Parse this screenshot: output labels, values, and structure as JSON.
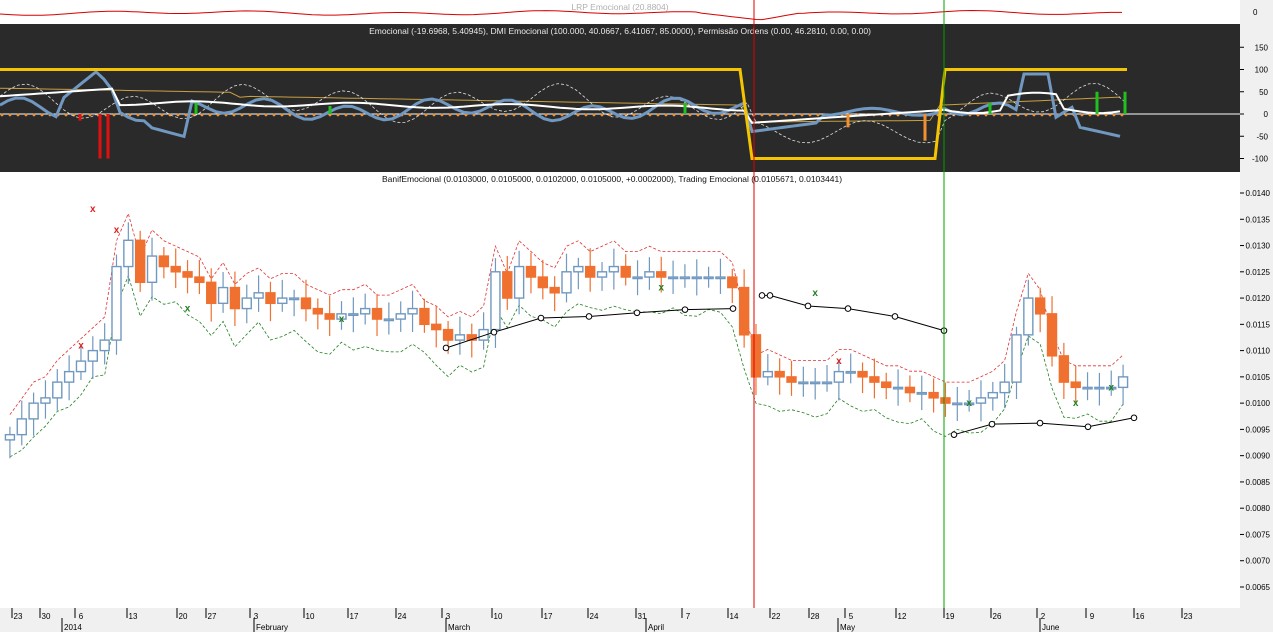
{
  "top_indicator": {
    "title": "LRP Emocional (20.8804)",
    "right_label": "0"
  },
  "oscillator": {
    "title": "Emocional (-19.6968, 5.40945), DMI Emocional (100.000, 40.0667, 6.41067, 85.0000), Permissão Ordens (0.00, 46.2810, 0.00, 0.00)",
    "y_ticks": [
      "150",
      "100",
      "50",
      "0",
      "-50",
      "-100"
    ],
    "y_values": [
      150,
      100,
      50,
      0,
      -50,
      -100
    ]
  },
  "price": {
    "title": "BanifEmocional (0.0103000, 0.0105000, 0.0102000, 0.0105000, +0.0002000), Trading Emocional (0.0105671, 0.0103441)",
    "y_ticks": [
      "0.0140",
      "0.0135",
      "0.0130",
      "0.0125",
      "0.0120",
      "0.0115",
      "0.0110",
      "0.0105",
      "0.0100",
      "0.0095",
      "0.0090",
      "0.0085",
      "0.0080",
      "0.0075",
      "0.0070",
      "0.0065"
    ],
    "y_values": [
      0.014,
      0.0135,
      0.013,
      0.0125,
      0.012,
      0.0115,
      0.011,
      0.0105,
      0.01,
      0.0095,
      0.009,
      0.0085,
      0.008,
      0.0075,
      0.007,
      0.0065
    ]
  },
  "x_axis": {
    "day_ticks": [
      "23",
      "30",
      "6",
      "13",
      "20",
      "27",
      "3",
      "10",
      "17",
      "24",
      "3",
      "10",
      "17",
      "24",
      "31",
      "7",
      "14",
      "22",
      "28",
      "5",
      "12",
      "19",
      "26",
      "2",
      "9",
      "16",
      "23"
    ],
    "month_labels": [
      "2014",
      "February",
      "March",
      "April",
      "May",
      "June"
    ]
  },
  "chart_data": {
    "type": "candlestick",
    "title": "BanifEmocional (0.0103000, 0.0105000, 0.0102000, 0.0105000, +0.0002000), Trading Emocional (0.0105671, 0.0103441)",
    "ylim": [
      0.0061,
      0.0144
    ],
    "series": [
      {
        "name": "BanifEmocional",
        "close": [
          0.0094,
          0.0097,
          0.01,
          0.0101,
          0.0104,
          0.0106,
          0.0108,
          0.011,
          0.0112,
          0.0126,
          0.0131,
          0.0123,
          0.0128,
          0.0126,
          0.0125,
          0.0124,
          0.0123,
          0.0119,
          0.0122,
          0.0118,
          0.012,
          0.0121,
          0.0119,
          0.012,
          0.012,
          0.0118,
          0.0117,
          0.0116,
          0.0117,
          0.0117,
          0.0118,
          0.0116,
          0.0116,
          0.0117,
          0.0118,
          0.0115,
          0.0114,
          0.0112,
          0.0113,
          0.0112,
          0.0114,
          0.0125,
          0.012,
          0.0126,
          0.0124,
          0.0122,
          0.0121,
          0.0125,
          0.0126,
          0.0124,
          0.0125,
          0.0126,
          0.0124,
          0.0124,
          0.0125,
          0.0124,
          0.0124,
          0.0124,
          0.0124,
          0.0124,
          0.0124,
          0.0122,
          0.0113,
          0.0105,
          0.0106,
          0.0105,
          0.0104,
          0.0104,
          0.0104,
          0.0104,
          0.0106,
          0.0106,
          0.0105,
          0.0104,
          0.0103,
          0.0103,
          0.0102,
          0.0102,
          0.0101,
          0.01,
          0.01,
          0.01,
          0.0101,
          0.0102,
          0.0104,
          0.0113,
          0.012,
          0.0117,
          0.0109,
          0.0104,
          0.0103,
          0.0103,
          0.0103,
          0.0103,
          0.0105
        ]
      },
      {
        "name": "Trading Emocional upper",
        "values": [
          0.0105671
        ]
      },
      {
        "name": "Trading Emocional lower",
        "values": [
          0.0103441
        ]
      }
    ]
  }
}
